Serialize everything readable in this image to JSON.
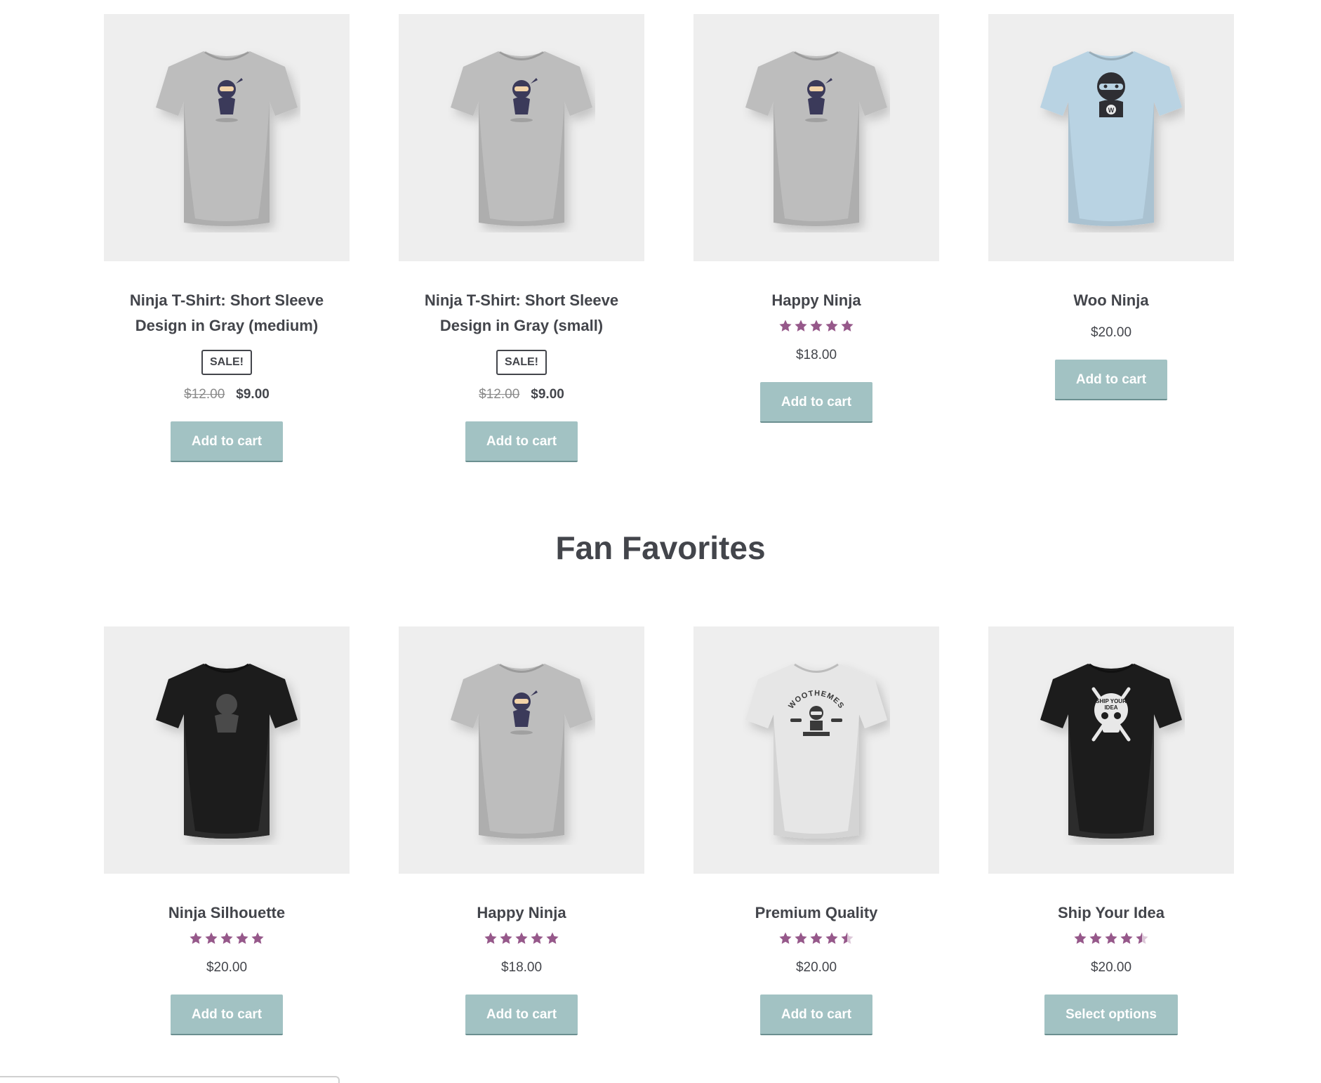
{
  "colors": {
    "star": "#96588a",
    "button": "#a2c2c3",
    "thumb_bg": "#eeeeee"
  },
  "section": {
    "title": "Fan Favorites"
  },
  "top_row": [
    {
      "title": "Ninja T-Shirt: Short Sleeve Design in Gray (medium)",
      "badge": "SALE!",
      "old_price": "$12.00",
      "price": "$9.00",
      "button": "Add to cart",
      "shirt": "gray-ninja"
    },
    {
      "title": "Ninja T-Shirt: Short Sleeve Design in Gray (small)",
      "badge": "SALE!",
      "old_price": "$12.00",
      "price": "$9.00",
      "button": "Add to cart",
      "shirt": "gray-ninja"
    },
    {
      "title": "Happy Ninja",
      "rating": 5,
      "price": "$18.00",
      "button": "Add to cart",
      "shirt": "gray-ninja"
    },
    {
      "title": "Woo Ninja",
      "price": "$20.00",
      "button": "Add to cart",
      "shirt": "blue-woo-ninja"
    }
  ],
  "bottom_row": [
    {
      "title": "Ninja Silhouette",
      "rating": 5,
      "price": "$20.00",
      "button": "Add to cart",
      "shirt": "black-silhouette"
    },
    {
      "title": "Happy Ninja",
      "rating": 5,
      "price": "$18.00",
      "button": "Add to cart",
      "shirt": "gray-ninja"
    },
    {
      "title": "Premium Quality",
      "rating": 4.5,
      "price": "$20.00",
      "button": "Add to cart",
      "shirt": "white-woothemes",
      "shirt_text": "WOOTHEMES"
    },
    {
      "title": "Ship Your Idea",
      "rating": 4.5,
      "price": "$20.00",
      "button": "Select options",
      "shirt": "black-skull",
      "shirt_text": "SHIP YOUR IDEA"
    }
  ]
}
